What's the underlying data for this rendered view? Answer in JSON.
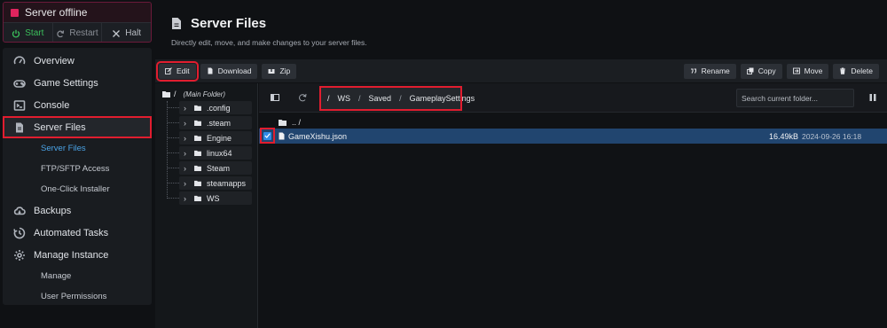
{
  "server": {
    "status": "Server offline",
    "status_color": "#e0245e",
    "start_label": "Start",
    "restart_label": "Restart",
    "halt_label": "Halt"
  },
  "nav": {
    "items": [
      {
        "label": "Overview",
        "icon": "gauge-icon"
      },
      {
        "label": "Game Settings",
        "icon": "gamepad-icon"
      },
      {
        "label": "Console",
        "icon": "terminal-icon"
      },
      {
        "label": "Server Files",
        "icon": "file-icon",
        "active": true
      },
      {
        "label": "Backups",
        "icon": "cloud-backup-icon"
      },
      {
        "label": "Automated Tasks",
        "icon": "tasks-icon"
      },
      {
        "label": "Manage Instance",
        "icon": "gear-icon"
      }
    ],
    "server_files_sub": [
      "Server Files",
      "FTP/SFTP Access",
      "One-Click Installer"
    ],
    "manage_sub": [
      "Manage",
      "User Permissions"
    ]
  },
  "page": {
    "title": "Server Files",
    "subtitle": "Directly edit, move, and make changes to your server files."
  },
  "toolbar": {
    "edit": "Edit",
    "download": "Download",
    "zip": "Zip",
    "rename": "Rename",
    "copy": "Copy",
    "move": "Move",
    "delete": "Delete"
  },
  "tree": {
    "root": "/",
    "root_note": "(Main Folder)",
    "folders": [
      ".config",
      ".steam",
      "Engine",
      "linux64",
      "Steam",
      "steamapps",
      "WS"
    ]
  },
  "browser": {
    "breadcrumb": [
      "/",
      "WS",
      "/",
      "Saved",
      "/",
      "GameplaySettings"
    ],
    "search_placeholder": "Search current folder...",
    "parent_label": ".. /",
    "file": {
      "name": "GameXishu.json",
      "size": "16.49kB",
      "modified": "2024-09-26 16:18",
      "selected": true
    }
  },
  "colors": {
    "accent": "#4aa3e6",
    "highlight": "#e11d2f",
    "selection": "#21456f",
    "start_green": "#3bbf5c"
  }
}
